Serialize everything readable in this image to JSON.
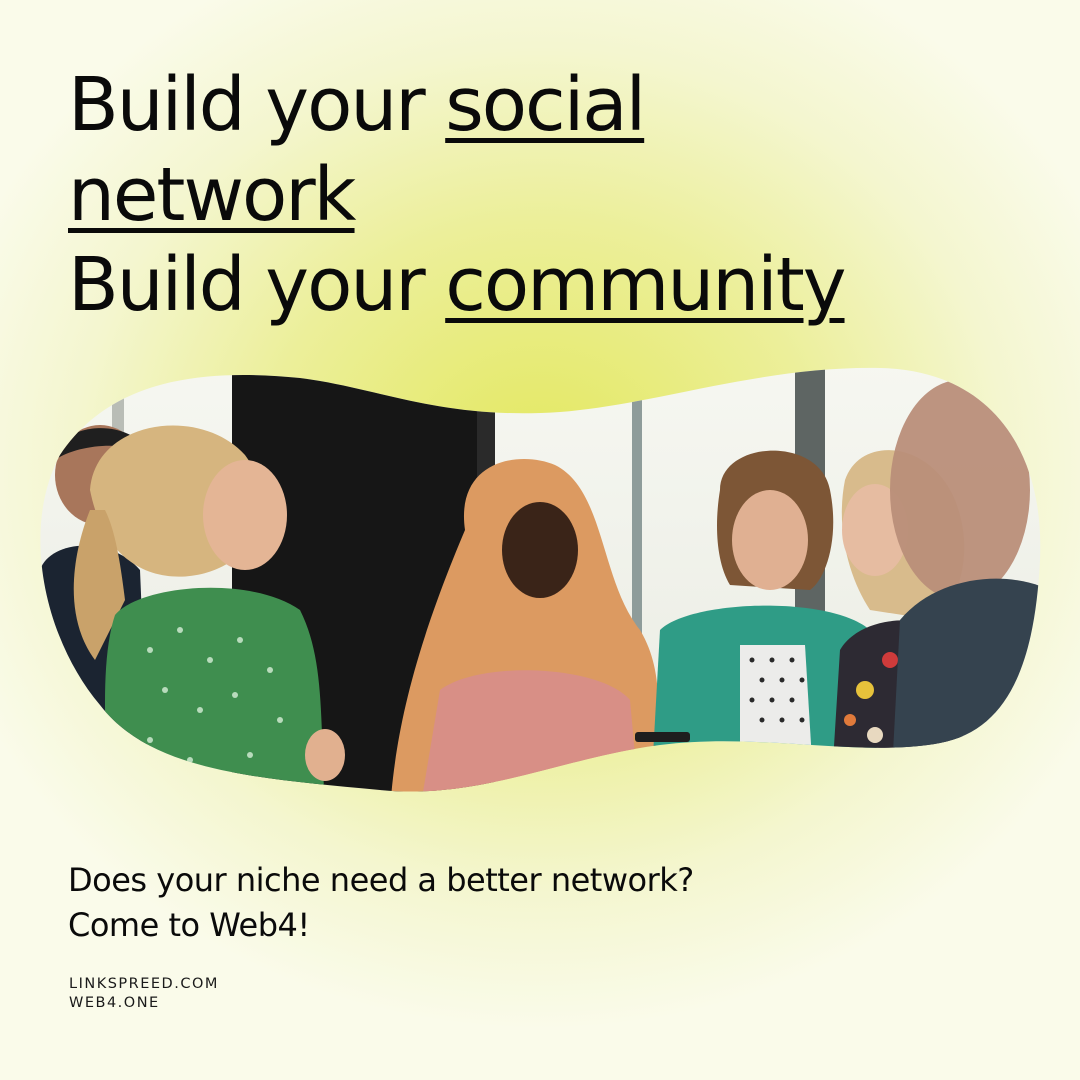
{
  "headline": {
    "line1_prefix": "Build your ",
    "line1_emphasis": "social",
    "line2_emphasis": "network ",
    "line3_prefix": "Build your ",
    "line3_emphasis": "community"
  },
  "photo": {
    "alt": "Group of people chatting at a networking event"
  },
  "tagline": {
    "line1": "Does your niche need a better network?",
    "line2": "Come to Web4!"
  },
  "links": {
    "site1": "LINKSPREED.COM",
    "site2": "WEB4.ONE"
  },
  "colors": {
    "background_center": "#e3e85e",
    "background_edge": "#fafbea",
    "text": "#0a0a0a"
  }
}
